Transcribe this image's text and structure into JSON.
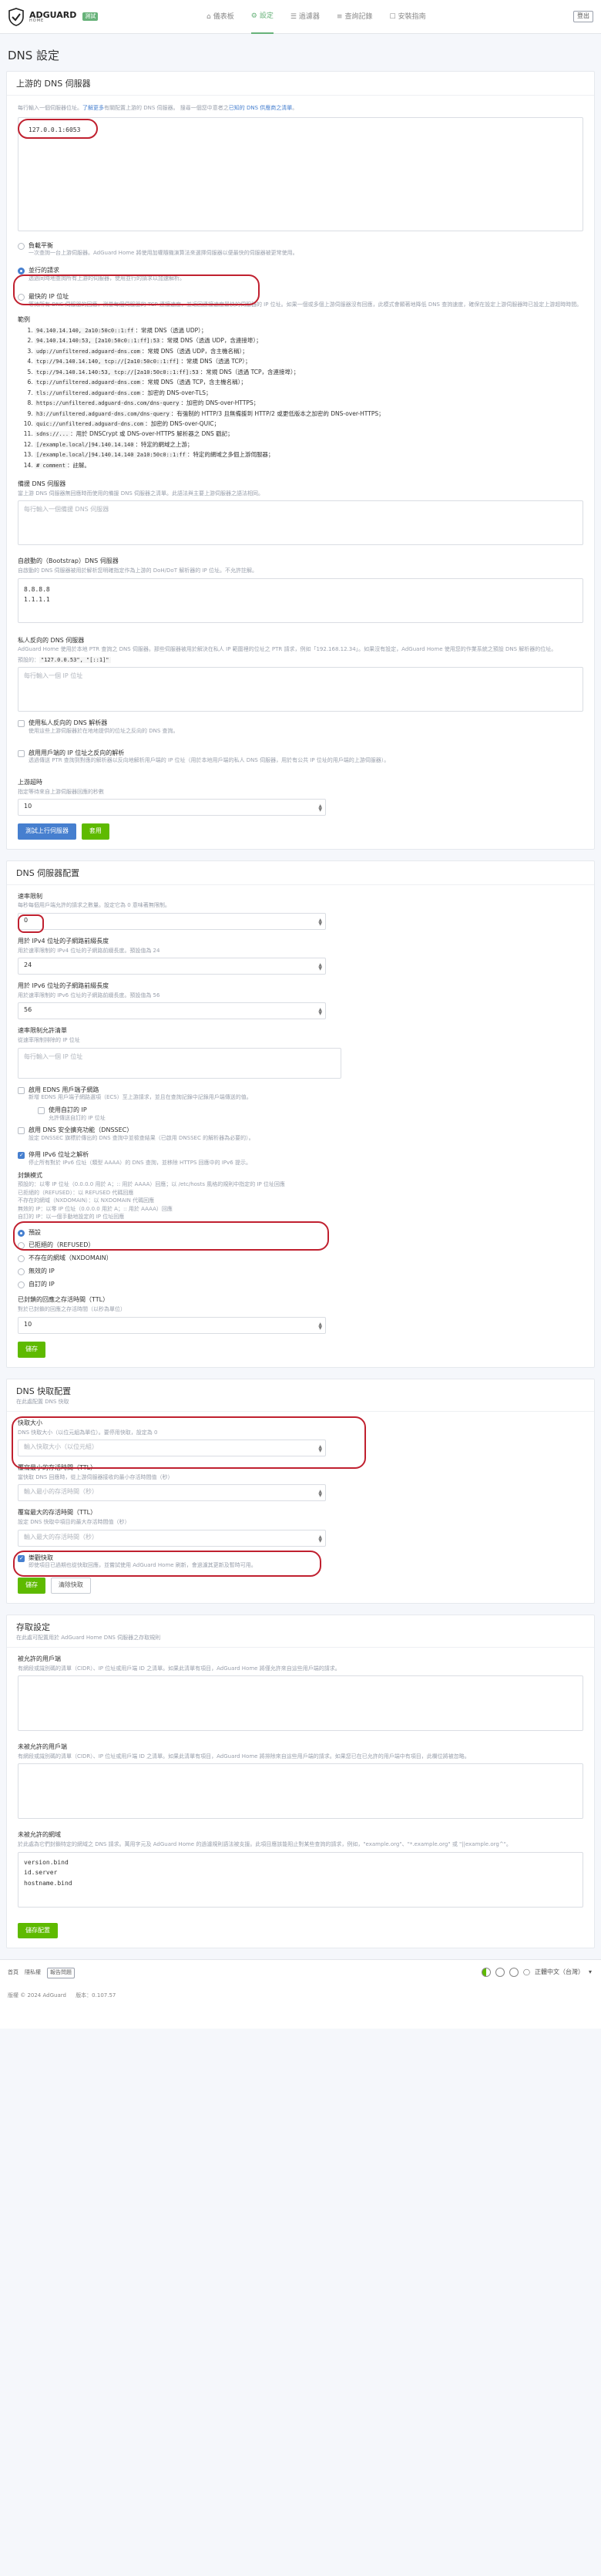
{
  "brand": {
    "name": "ADGUARD",
    "sub": "HOME",
    "badge": "測試"
  },
  "nav": [
    {
      "label": "儀表板",
      "icon": "⌂"
    },
    {
      "label": "設定",
      "icon": "⚙"
    },
    {
      "label": "過濾器",
      "icon": "☰"
    },
    {
      "label": "查詢記錄",
      "icon": "≡"
    },
    {
      "label": "安裝指南",
      "icon": "☐"
    }
  ],
  "logout": "登出",
  "page_title": "DNS 設定",
  "upstream": {
    "title": "上游的 DNS 伺服器",
    "desc_prefix": "每行輸入一個伺服器位址。",
    "desc_link1": "了解更多",
    "desc_mid": "有關配置上游的 DNS 伺服器。 搜尋一個您中意者之",
    "desc_link2": "已知的 DNS 供應商之清單",
    "desc_suffix": "。",
    "value": "127.0.0.1:6053",
    "modes": [
      {
        "title": "負載平衡",
        "desc": "一次查詢一台上游伺服器。AdGuard Home 將使用加權隨機演算法來選擇伺服器以便最快的伺服器被更常使用。"
      },
      {
        "title": "並行的請求",
        "desc": "透過同時地查詢所有上游的伺服器，使用並行的請求以加速解析。"
      },
      {
        "title": "最快的 IP 位址",
        "desc": "等待所有 DNS 伺服器的回應，測量每個伺服器的 TCP 連接速度，並返回連接速度最快的伺服器的 IP 位址。如果一個或多個上游伺服器沒有回應，此模式會顯著地降低 DNS 查詢速度，確保在設定上游伺服器時已設定上游超時時間。"
      }
    ],
    "examples_title": "範例",
    "examples": [
      {
        "code": "94.140.14.140, 2a10:50c0::1:ff",
        "text": "：常規 DNS（透過 UDP）；"
      },
      {
        "code": "94.140.14.140:53, [2a10:50c0::1:ff]:53",
        "text": "：常規 DNS（透過 UDP，含連接埠）；"
      },
      {
        "code": "udp://unfiltered.adguard-dns.com",
        "text": "：常規 DNS（透過 UDP，含主機名稱）；"
      },
      {
        "code": "tcp://94.140.14.140, tcp://[2a10:50c0::1:ff]",
        "text": "：常規 DNS（透過 TCP）；"
      },
      {
        "code": "tcp://94.140.14.140:53, tcp://[2a10:50c0::1:ff]:53",
        "text": "：常規 DNS（透過 TCP，含連接埠）；"
      },
      {
        "code": "tcp://unfiltered.adguard-dns.com",
        "text": "：常規 DNS（透過 TCP，含主機名稱）；"
      },
      {
        "code": "tls://unfiltered.adguard-dns.com",
        "text": "：加密的 DNS-over-TLS；"
      },
      {
        "code": "https://unfiltered.adguard-dns.com/dns-query",
        "text": "：加密的 DNS-over-HTTPS；"
      },
      {
        "code": "h3://unfiltered.adguard-dns.com/dns-query",
        "text": "：有強制的 HTTP/3 且無備援到 HTTP/2 或更低版本之加密的 DNS-over-HTTPS；"
      },
      {
        "code": "quic://unfiltered.adguard-dns.com",
        "text": "：加密的 DNS-over-QUIC；"
      },
      {
        "code": "sdns://...",
        "text": "：用於 DNSCrypt 或 DNS-over-HTTPS 解析器之 DNS 戳記；"
      },
      {
        "code": "[/example.local/]94.140.14.140",
        "text": "：特定的網域之上游；"
      },
      {
        "code": "[/example.local/]94.140.14.140 2a10:50c0::1:ff",
        "text": "：特定的網域之多個上游伺服器；"
      },
      {
        "code": "# comment",
        "text": "：註解。"
      }
    ]
  },
  "fallback": {
    "label": "備援 DNS 伺服器",
    "desc": "當上游 DNS 伺服器無回應時而使用的備援 DNS 伺服器之清單。此語法與主要上游伺服器之語法相同。",
    "placeholder": "每行輸入一個備援 DNS 伺服器"
  },
  "bootstrap": {
    "label": "自啟動的（Bootstrap）DNS 伺服器",
    "desc": "自啟動的 DNS 伺服器被用於解析您明確指定作為上游的 DoH/DoT 解析器的 IP 位址。不允許註解。",
    "lines": [
      "8.8.8.8",
      "1.1.1.1"
    ]
  },
  "private": {
    "label": "私人反向的 DNS 伺服器",
    "desc": "AdGuard Home 使用於本地 PTR 查詢之 DNS 伺服器。那些伺服器被用於解決在私人 IP 範圍裡的位址之 PTR 請求，例如「192.168.12.34」。如果沒有設定，AdGuard Home 使用您的作業系統之預設 DNS 解析器的位址。",
    "default_prefix": "預設的：",
    "default_value": "\"127.0.0.53\", \"[::1]\"",
    "placeholder": "每行輸入一個 IP 位址",
    "use_private_title": "使用私人反向的 DNS 解析器",
    "use_private_desc": "使用這些上游伺服器於在地地提供的位址之反向的 DNS 查詢。",
    "rdns_title": "啟用用戶端的 IP 位址之反向的解析",
    "rdns_desc": "透過傳送 PTR 查詢到對應的解析器以反向地解析用戶端的 IP 位址（用於本地用戶端的私人 DNS 伺服器，用於有公共 IP 位址的用戶端的上游伺服器）。"
  },
  "timeout": {
    "label": "上游超時",
    "desc": "指定等待來自上游伺服器回應的秒數",
    "value": "10"
  },
  "upstream_buttons": {
    "test": "測試上行伺服器",
    "apply": "套用"
  },
  "dns_config": {
    "title": "DNS 伺服器配置",
    "rate_limit_label": "速率限制",
    "rate_limit_desc": "每秒每個用戶端允許的請求之數量。設定它為 0 意味著無限制。",
    "rate_limit_value": "0",
    "v4_label": "用於 IPv4 位址的子網路前綴長度",
    "v4_desc": "用於速率限制的 IPv4 位址的子網路前綴長度。預設值為 24",
    "v4_value": "24",
    "v6_label": "用於 IPv6 位址的子網路前綴長度",
    "v6_desc": "用於速率限制的 IPv6 位址的子網路前綴長度。預設值為 56",
    "v6_value": "56",
    "allow_label": "速率限制允許清單",
    "allow_desc": "從速率限制排除的 IP 位址",
    "allow_placeholder": "每行輸入一個 IP 位址",
    "edns_title": "啟用 EDNS 用戶端子網路",
    "edns_desc": "新增 EDNS 用戶端子網路選項（ECS）至上游請求，並且在查詢記錄中記錄用戶端傳送的值。",
    "edns_custom_title": "使用自訂的 IP",
    "edns_custom_desc": "允許傳送自訂的 IP 位址",
    "dnssec_title": "啟用 DNS 安全擴充功能（DNSSEC）",
    "dnssec_desc": "設定 DNSSEC 旗標於傳出的 DNS 查詢中並檢查結果（已啟用 DNSSEC 的解析器為必要的）。",
    "ipv6_title": "停用 IPv6 位址之解析",
    "ipv6_desc": "停止所有對於 IPv6 位址（類型 AAAA）的 DNS 查詢，並移除 HTTPS 回應中的 IPv6 提示。",
    "blocking_title": "封鎖模式",
    "blocking_lines": [
      "預設的：以零 IP 位址（0.0.0.0 用於 A；:: 用於 AAAA）回應；以 /etc/hosts 風格的規則中指定的 IP 位址回應",
      "已拒絕的（REFUSED）：以 REFUSED 代碼回應",
      "不存在的網域（NXDOMAIN）：以 NXDOMAIN 代碼回應",
      "無效的 IP：以零 IP 位址（0.0.0.0 用於 A；:: 用於 AAAA）回應",
      "自訂的 IP：以一個手動地設定的 IP 位址回應"
    ],
    "blocking_options": [
      "預設",
      "已拒絕的（REFUSED）",
      "不存在的網域（NXDOMAIN）",
      "無效的 IP",
      "自訂的 IP"
    ],
    "ttl_label": "已封鎖的回應之存活時間（TTL）",
    "ttl_desc": "對於已封鎖的回應之存活時間（以秒為單位）",
    "ttl_value": "10",
    "save": "儲存"
  },
  "cache": {
    "title": "DNS 快取配置",
    "sub": "在此處配置 DNS 快取",
    "size_label": "快取大小",
    "size_desc": "DNS 快取大小（以位元組為單位）。要停用快取，設定為 0",
    "size_placeholder": "輸入快取大小（以位元組）",
    "min_label": "覆寫最小的存活時間（TTL）",
    "min_desc": "當快取 DNS 回應時，從上游伺服器接收的最小存活時間值（秒）",
    "min_placeholder": "輸入最小的存活時間（秒）",
    "max_label": "覆寫最大的存活時間（TTL）",
    "max_desc": "設定 DNS 快取中項目的最大存活時間值（秒）",
    "max_placeholder": "輸入最大的存活時間（秒）",
    "optimistic_title": "樂觀快取",
    "optimistic_desc": "即使項目已過期也從快取回應，並嘗試使用 AdGuard Home 刷新，會過濾其更新及暫時可用。",
    "save": "儲存",
    "clear": "清除快取"
  },
  "access": {
    "title": "存取設定",
    "sub": "在此處可配置用於 AdGuard Home DNS 伺服器之存取規則",
    "allowed_label": "被允許的用戶端",
    "allowed_desc": "有網段或識別碼的清單（CIDR）、IP 位址或用戶端 ID 之清單。如果此清單有項目，AdGuard Home 將僅允許來自這些用戶端的請求。",
    "disallowed_label": "未被允許的用戶端",
    "disallowed_desc": "有網段或識別碼的清單（CIDR）、IP 位址或用戶端 ID 之清單。如果此清單有項目，AdGuard Home 將排除來自這些用戶端的請求。如果您已在已允許的用戶端中有項目，此欄位將被忽略。",
    "blocked_label": "未被允許的網域",
    "blocked_desc": "於此處為它們封鎖特定的網域之 DNS 請求。萬用字元及 AdGuard Home 的過濾規則語法被支援。此項目應該能阻止對某些查詢的請求，例如，\"example.org\"、\"*.example.org\" 或 \"||example.org^\"。",
    "blocked_lines": [
      "version.bind",
      "id.server",
      "hostname.bind"
    ],
    "save": "儲存配置"
  },
  "footer": {
    "links": [
      "首頁",
      "隱私權",
      "報告問題"
    ],
    "report_label": "報告問題",
    "language": "正體中文（台灣）",
    "copyright": "版權 © 2024 AdGuard",
    "version": "版本：0.107.57"
  },
  "colors": {
    "accent": "#67b279",
    "link": "#467fcf",
    "save": "#5eba00",
    "annotation": "#c0202f"
  }
}
